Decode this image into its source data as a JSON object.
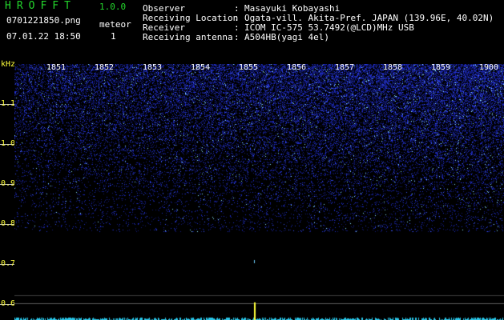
{
  "header": {
    "app_title": "HROFFT",
    "app_version": "1.0.0",
    "filename": "0701221850.png",
    "datetime": "07.01.22 18:50",
    "meteor_label": "meteor",
    "meteor_count": "1"
  },
  "info": [
    {
      "label": "Observer",
      "value": "Masayuki Kobayashi"
    },
    {
      "label": "Receiving Location",
      "value": "Ogata-vill. Akita-Pref. JAPAN (139.96E, 40.02N)"
    },
    {
      "label": "Receiver",
      "value": "ICOM IC-575 53.7492(@LCD)MHz USB"
    },
    {
      "label": "Receiving antenna",
      "value": "A504HB(yagi 4el)"
    }
  ],
  "axis": {
    "y_unit": "kHz",
    "y_labels": [
      "1.1",
      "1.0",
      "0.9",
      "0.8",
      "0.7",
      "0.6"
    ],
    "x_labels": [
      "1851",
      "1852",
      "1853",
      "1854",
      "1855",
      "1856",
      "1857",
      "1858",
      "1859",
      "1900"
    ]
  },
  "colors": {
    "background": "#000000",
    "header_green": "#23d62c",
    "axis_yellow": "#ffff3a",
    "noise_blue": "#1f2cc8",
    "trace_cyan": "#29c6e8",
    "meteor_yellow": "#ffff3a"
  }
}
